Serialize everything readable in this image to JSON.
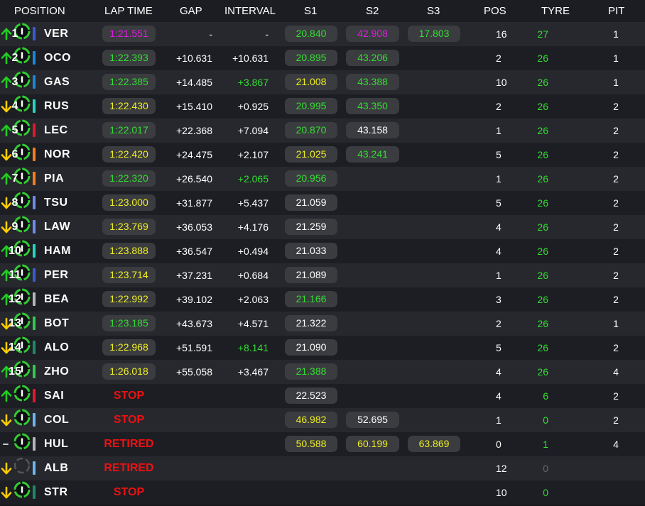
{
  "colors": {
    "purple": "#e11ce1",
    "green": "#33dd33",
    "yellow": "#eeee22",
    "stop_red": "#ee1111",
    "up_arrow": "#22cc22",
    "down_arrow": "#ffcc00"
  },
  "headers": {
    "position": "POSITION",
    "lap_time": "LAP TIME",
    "gap": "GAP",
    "interval": "INTERVAL",
    "s1": "S1",
    "s2": "S2",
    "s3": "S3",
    "pos": "POS",
    "tyre": "TYRE",
    "pit": "PIT"
  },
  "rows": [
    {
      "pos": "1",
      "team_color": "#3a5bd0",
      "code": "VER",
      "lap": "1:21.551",
      "lap_c": "purple",
      "status": "",
      "gap": "-",
      "int": "-",
      "int_c": "white",
      "s1": "20.840",
      "s1_c": "green",
      "s2": "42.908",
      "s2_c": "purple",
      "s3": "17.803",
      "s3_c": "green",
      "dir": "up",
      "poschg": "16",
      "laps": "27",
      "laps_c": "green",
      "tyre_icon": "tyre-icon",
      "pit": "1"
    },
    {
      "pos": "2",
      "team_color": "#1e86d6",
      "code": "OCO",
      "lap": "1:22.393",
      "lap_c": "green",
      "status": "",
      "gap": "+10.631",
      "int": "+10.631",
      "int_c": "white",
      "s1": "20.895",
      "s1_c": "green",
      "s2": "43.206",
      "s2_c": "green",
      "s3": "",
      "s3_c": "white",
      "dir": "up",
      "poschg": "2",
      "laps": "26",
      "laps_c": "green",
      "tyre_icon": "tyre-icon",
      "pit": "1"
    },
    {
      "pos": "3",
      "team_color": "#1e86d6",
      "code": "GAS",
      "lap": "1:22.385",
      "lap_c": "green",
      "status": "",
      "gap": "+14.485",
      "int": "+3.867",
      "int_c": "green",
      "s1": "21.008",
      "s1_c": "yellow",
      "s2": "43.388",
      "s2_c": "green",
      "s3": "",
      "s3_c": "white",
      "dir": "up",
      "poschg": "10",
      "laps": "26",
      "laps_c": "green",
      "tyre_icon": "tyre-icon",
      "pit": "1"
    },
    {
      "pos": "4",
      "team_color": "#22d6c4",
      "code": "RUS",
      "lap": "1:22.430",
      "lap_c": "yellow",
      "status": "",
      "gap": "+15.410",
      "int": "+0.925",
      "int_c": "white",
      "s1": "20.995",
      "s1_c": "green",
      "s2": "43.350",
      "s2_c": "green",
      "s3": "",
      "s3_c": "white",
      "dir": "down",
      "poschg": "2",
      "laps": "26",
      "laps_c": "green",
      "tyre_icon": "tyre-icon",
      "pit": "2"
    },
    {
      "pos": "5",
      "team_color": "#e0192f",
      "code": "LEC",
      "lap": "1:22.017",
      "lap_c": "green",
      "status": "",
      "gap": "+22.368",
      "int": "+7.094",
      "int_c": "white",
      "s1": "20.870",
      "s1_c": "green",
      "s2": "43.158",
      "s2_c": "white",
      "s3": "",
      "s3_c": "white",
      "dir": "up",
      "poschg": "1",
      "laps": "26",
      "laps_c": "green",
      "tyre_icon": "tyre-icon",
      "pit": "2"
    },
    {
      "pos": "6",
      "team_color": "#f47f1c",
      "code": "NOR",
      "lap": "1:22.420",
      "lap_c": "yellow",
      "status": "",
      "gap": "+24.475",
      "int": "+2.107",
      "int_c": "white",
      "s1": "21.025",
      "s1_c": "yellow",
      "s2": "43.241",
      "s2_c": "green",
      "s3": "",
      "s3_c": "white",
      "dir": "down",
      "poschg": "5",
      "laps": "26",
      "laps_c": "green",
      "tyre_icon": "tyre-icon",
      "pit": "2"
    },
    {
      "pos": "7",
      "team_color": "#f47f1c",
      "code": "PIA",
      "lap": "1:22.320",
      "lap_c": "green",
      "status": "",
      "gap": "+26.540",
      "int": "+2.065",
      "int_c": "green",
      "s1": "20.956",
      "s1_c": "green",
      "s2": "",
      "s2_c": "white",
      "s3": "",
      "s3_c": "white",
      "dir": "up",
      "poschg": "1",
      "laps": "26",
      "laps_c": "green",
      "tyre_icon": "tyre-icon",
      "pit": "2"
    },
    {
      "pos": "8",
      "team_color": "#6c8cf0",
      "code": "TSU",
      "lap": "1:23.000",
      "lap_c": "yellow",
      "status": "",
      "gap": "+31.877",
      "int": "+5.437",
      "int_c": "white",
      "s1": "21.059",
      "s1_c": "white",
      "s2": "",
      "s2_c": "white",
      "s3": "",
      "s3_c": "white",
      "dir": "down",
      "poschg": "5",
      "laps": "26",
      "laps_c": "green",
      "tyre_icon": "tyre-icon",
      "pit": "2"
    },
    {
      "pos": "9",
      "team_color": "#6c8cf0",
      "code": "LAW",
      "lap": "1:23.769",
      "lap_c": "yellow",
      "status": "",
      "gap": "+36.053",
      "int": "+4.176",
      "int_c": "white",
      "s1": "21.259",
      "s1_c": "white",
      "s2": "",
      "s2_c": "white",
      "s3": "",
      "s3_c": "white",
      "dir": "down",
      "poschg": "4",
      "laps": "26",
      "laps_c": "green",
      "tyre_icon": "tyre-icon",
      "pit": "2"
    },
    {
      "pos": "10",
      "team_color": "#22d6c4",
      "code": "HAM",
      "lap": "1:23.888",
      "lap_c": "yellow",
      "status": "",
      "gap": "+36.547",
      "int": "+0.494",
      "int_c": "white",
      "s1": "21.033",
      "s1_c": "white",
      "s2": "",
      "s2_c": "white",
      "s3": "",
      "s3_c": "white",
      "dir": "up",
      "poschg": "4",
      "laps": "26",
      "laps_c": "green",
      "tyre_icon": "tyre-icon",
      "pit": "2"
    },
    {
      "pos": "11",
      "team_color": "#3a5bd0",
      "code": "PER",
      "lap": "1:23.714",
      "lap_c": "yellow",
      "status": "",
      "gap": "+37.231",
      "int": "+0.684",
      "int_c": "white",
      "s1": "21.089",
      "s1_c": "white",
      "s2": "",
      "s2_c": "white",
      "s3": "",
      "s3_c": "white",
      "dir": "up",
      "poschg": "1",
      "laps": "26",
      "laps_c": "green",
      "tyre_icon": "tyre-icon",
      "pit": "2"
    },
    {
      "pos": "12",
      "team_color": "#b4b6bb",
      "code": "BEA",
      "lap": "1:22.992",
      "lap_c": "yellow",
      "status": "",
      "gap": "+39.102",
      "int": "+2.063",
      "int_c": "white",
      "s1": "21.166",
      "s1_c": "green",
      "s2": "",
      "s2_c": "white",
      "s3": "",
      "s3_c": "white",
      "dir": "up",
      "poschg": "3",
      "laps": "26",
      "laps_c": "green",
      "tyre_icon": "tyre-icon",
      "pit": "2"
    },
    {
      "pos": "13",
      "team_color": "#34c94c",
      "code": "BOT",
      "lap": "1:23.185",
      "lap_c": "green",
      "status": "",
      "gap": "+43.673",
      "int": "+4.571",
      "int_c": "white",
      "s1": "21.322",
      "s1_c": "white",
      "s2": "",
      "s2_c": "white",
      "s3": "",
      "s3_c": "white",
      "dir": "down",
      "poschg": "2",
      "laps": "26",
      "laps_c": "green",
      "tyre_icon": "tyre-icon",
      "pit": "1"
    },
    {
      "pos": "14",
      "team_color": "#1d8a6a",
      "code": "ALO",
      "lap": "1:22.968",
      "lap_c": "yellow",
      "status": "",
      "gap": "+51.591",
      "int": "+8.141",
      "int_c": "green",
      "s1": "21.090",
      "s1_c": "white",
      "s2": "",
      "s2_c": "white",
      "s3": "",
      "s3_c": "white",
      "dir": "down",
      "poschg": "5",
      "laps": "26",
      "laps_c": "green",
      "tyre_icon": "tyre-icon",
      "pit": "2"
    },
    {
      "pos": "15",
      "team_color": "#34c94c",
      "code": "ZHO",
      "lap": "1:26.018",
      "lap_c": "yellow",
      "status": "",
      "gap": "+55.058",
      "int": "+3.467",
      "int_c": "white",
      "s1": "21.388",
      "s1_c": "green",
      "s2": "",
      "s2_c": "white",
      "s3": "",
      "s3_c": "white",
      "dir": "up",
      "poschg": "4",
      "laps": "26",
      "laps_c": "green",
      "tyre_icon": "tyre-icon",
      "pit": "4"
    },
    {
      "pos": "",
      "team_color": "#e0192f",
      "code": "SAI",
      "lap": "",
      "lap_c": "white",
      "status": "STOP",
      "gap": "",
      "int": "",
      "int_c": "white",
      "s1": "22.523",
      "s1_c": "white",
      "s2": "",
      "s2_c": "white",
      "s3": "",
      "s3_c": "white",
      "dir": "up",
      "poschg": "4",
      "laps": "6",
      "laps_c": "green",
      "tyre_icon": "tyre-icon",
      "pit": "2"
    },
    {
      "pos": "",
      "team_color": "#6cb6f0",
      "code": "COL",
      "lap": "",
      "lap_c": "white",
      "status": "STOP",
      "gap": "",
      "int": "",
      "int_c": "white",
      "s1": "46.982",
      "s1_c": "yellow",
      "s2": "52.695",
      "s2_c": "white",
      "s3": "",
      "s3_c": "white",
      "dir": "down",
      "poschg": "1",
      "laps": "0",
      "laps_c": "green",
      "tyre_icon": "tyre-icon",
      "pit": "2"
    },
    {
      "pos": "",
      "team_color": "#b4b6bb",
      "code": "HUL",
      "lap": "",
      "lap_c": "white",
      "status": "RETIRED",
      "gap": "",
      "int": "",
      "int_c": "white",
      "s1": "50.588",
      "s1_c": "yellow",
      "s2": "60.199",
      "s2_c": "yellow",
      "s3": "63.869",
      "s3_c": "yellow",
      "dir": "none",
      "poschg": "0",
      "laps": "1",
      "laps_c": "green",
      "tyre_icon": "tyre-icon",
      "pit": "4"
    },
    {
      "pos": "",
      "team_color": "#6cb6f0",
      "code": "ALB",
      "lap": "",
      "lap_c": "white",
      "status": "RETIRED",
      "gap": "",
      "int": "",
      "int_c": "white",
      "s1": "",
      "s1_c": "white",
      "s2": "",
      "s2_c": "white",
      "s3": "",
      "s3_c": "white",
      "dir": "down",
      "poschg": "12",
      "laps": "0",
      "laps_c": "gray",
      "tyre_icon": "tyre-unknown-icon",
      "pit": ""
    },
    {
      "pos": "",
      "team_color": "#1d8a6a",
      "code": "STR",
      "lap": "",
      "lap_c": "white",
      "status": "STOP",
      "gap": "",
      "int": "",
      "int_c": "white",
      "s1": "",
      "s1_c": "white",
      "s2": "",
      "s2_c": "white",
      "s3": "",
      "s3_c": "white",
      "dir": "down",
      "poschg": "10",
      "laps": "0",
      "laps_c": "green",
      "tyre_icon": "tyre-icon",
      "pit": ""
    }
  ]
}
